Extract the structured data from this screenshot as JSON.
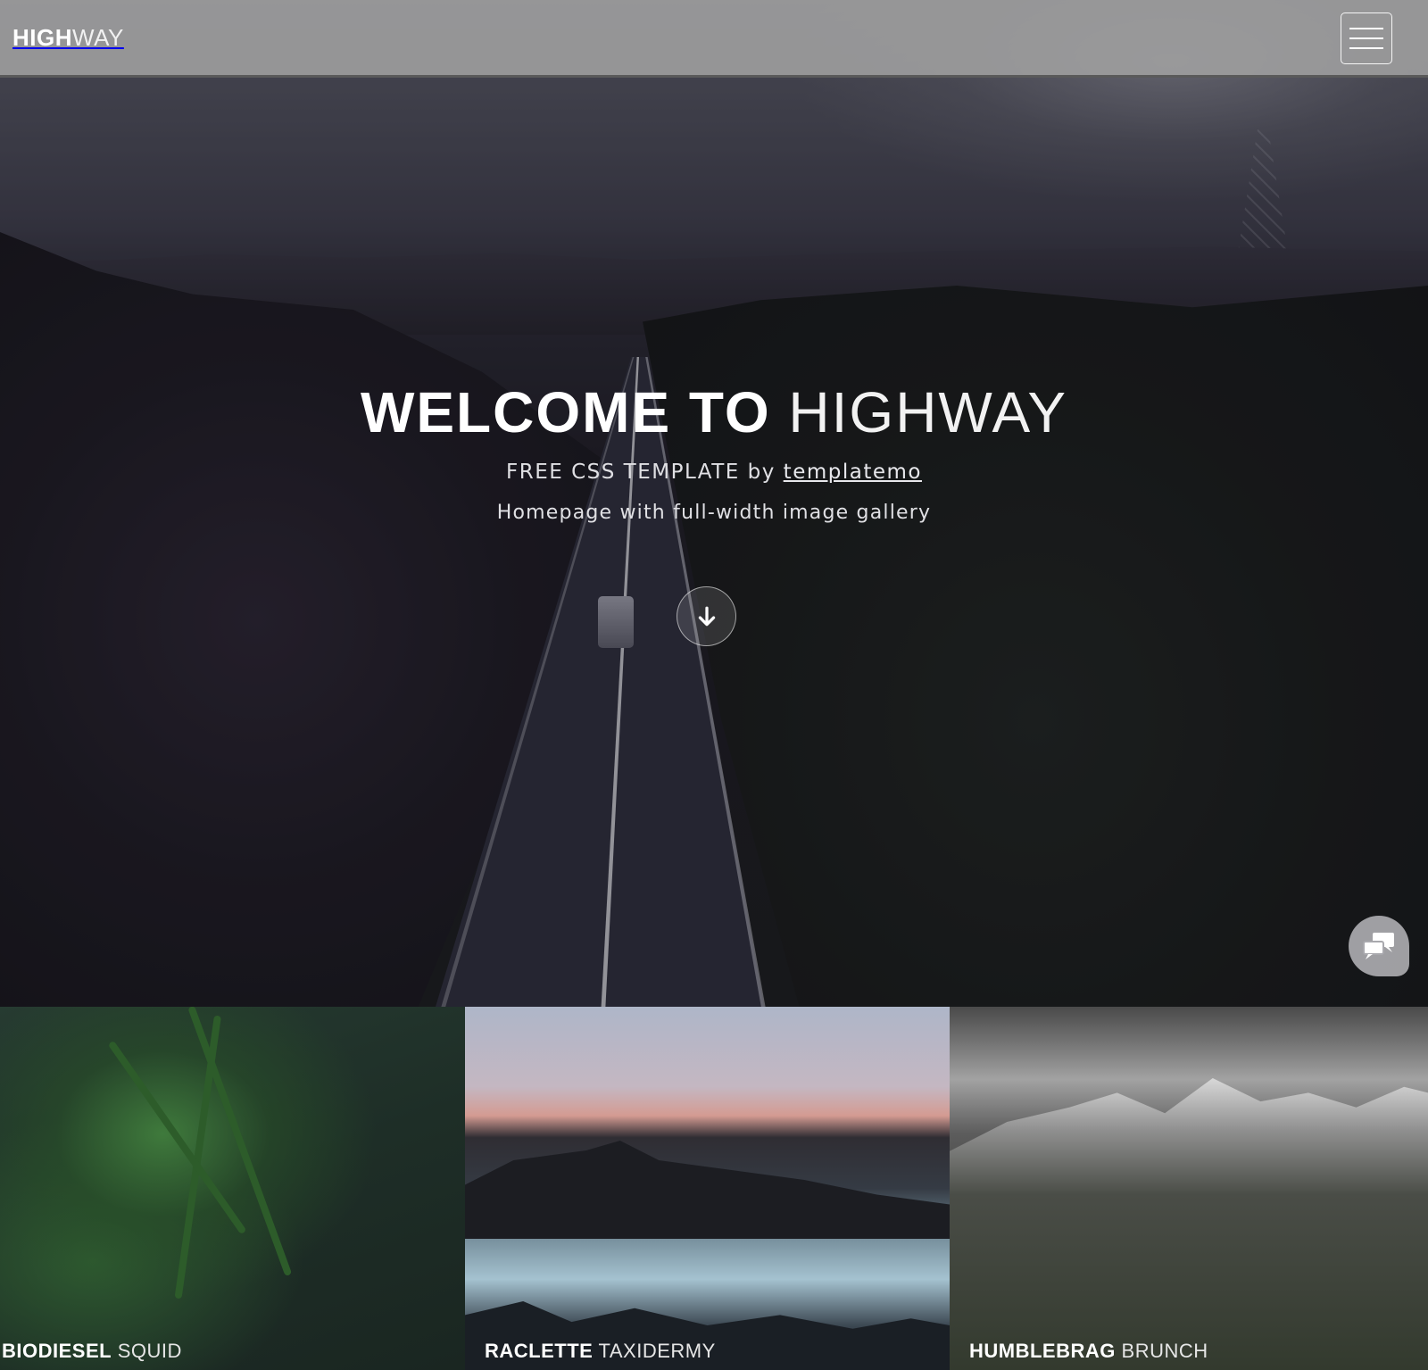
{
  "navbar": {
    "brand_bold": "HIGH",
    "brand_light": "WAY",
    "menu_icon": "hamburger-menu-icon"
  },
  "hero": {
    "title_bold": "WELCOME TO",
    "title_light": "HIGHWAY",
    "subtitle_prefix": "FREE CSS TEMPLATE by ",
    "subtitle_link": "templatemo",
    "tagline": "Homepage with full-width image gallery",
    "scroll_icon": "arrow-down-icon",
    "chat_icon": "chat-bubbles-icon"
  },
  "gallery": {
    "tiles": [
      {
        "title_bold": "BIODIESEL",
        "title_light": "SQUID"
      },
      {
        "title_bold": "RACLETTE",
        "title_light": "TAXIDERMY"
      },
      {
        "title_bold": "HUMBLEBRAG",
        "title_light": "BRUNCH"
      }
    ]
  }
}
